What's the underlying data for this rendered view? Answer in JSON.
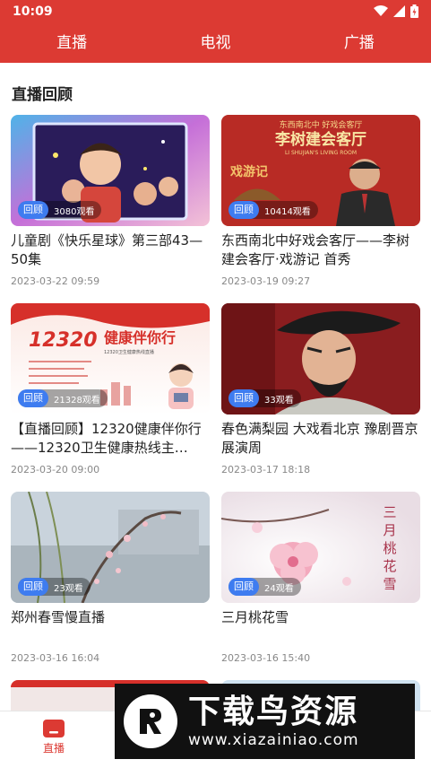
{
  "status_bar": {
    "time": "10:09"
  },
  "top_tabs": [
    {
      "label": "直播"
    },
    {
      "label": "电视"
    },
    {
      "label": "广播"
    }
  ],
  "section_title": "直播回顾",
  "cards": [
    {
      "tag": "回顾",
      "views": "3080观看",
      "title": "儿童剧《快乐星球》第三部43—50集",
      "date": "2023-03-22 09:59"
    },
    {
      "tag": "回顾",
      "views": "10414观看",
      "title": "东西南北中好戏会客厅——李树建会客厅·戏游记 首秀",
      "date": "2023-03-19 09:27",
      "thumb_text": {
        "top": "东西南北中 好戏会客厅",
        "main": "李树建会客厅",
        "sub": "LI SHUJIAN'S LIVING ROOM",
        "logo": "戏游记"
      }
    },
    {
      "tag": "回顾",
      "views": "21328观看",
      "title": "【直播回顾】12320健康伴你行——12320卫生健康热线主…",
      "date": "2023-03-20 09:00",
      "thumb_text": {
        "number": "12320",
        "slogan": "健康伴你行",
        "sub": "12320卫生健康热线直播"
      }
    },
    {
      "tag": "回顾",
      "views": "33观看",
      "title": "春色满梨园 大戏看北京 豫剧晋京展演周",
      "date": "2023-03-17 18:18"
    },
    {
      "tag": "回顾",
      "views": "23观看",
      "title": "郑州春雪慢直播",
      "date": "2023-03-16 16:04"
    },
    {
      "tag": "回顾",
      "views": "24观看",
      "title": "三月桃花雪",
      "date": "2023-03-16 15:40",
      "thumb_text": {
        "vertical": "三月桃花雪"
      }
    }
  ],
  "bottom_nav": {
    "live_label": "直播"
  },
  "watermark": {
    "title": "下载鸟资源",
    "url": "www.xiazainiao.com"
  },
  "colors": {
    "brand_red": "#dc3a33",
    "tag_blue": "#3e7cf0"
  },
  "icons": {
    "wifi": "wifi-icon",
    "signal": "signal-icon",
    "battery": "battery-icon",
    "nav_live": "live-tv-icon"
  }
}
